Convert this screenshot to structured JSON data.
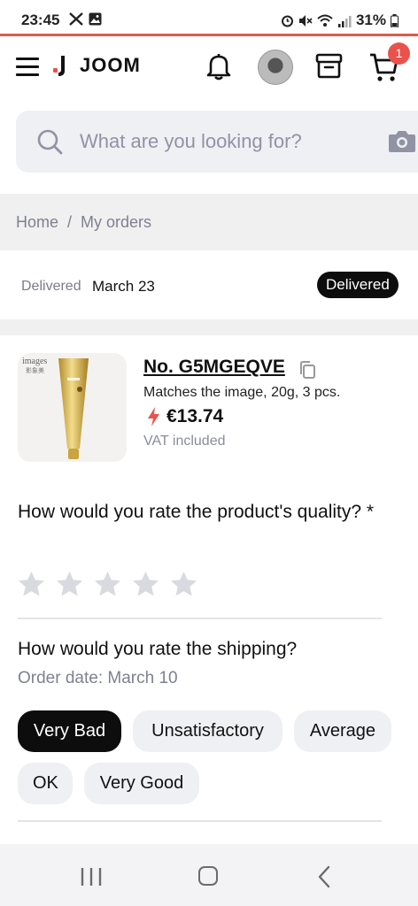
{
  "status_bar": {
    "time": "23:45",
    "battery": "31%",
    "icons": [
      "x-logo-icon",
      "image-icon",
      "alarm-icon",
      "mute-icon",
      "wifi-icon",
      "signal-icon",
      "battery-icon"
    ]
  },
  "header": {
    "brand": "JOOM",
    "cart_count": "1",
    "accent_color": "#e9534b",
    "icons": [
      "menu-icon",
      "bell-icon",
      "avatar",
      "archive-box-icon",
      "cart-icon"
    ]
  },
  "search": {
    "placeholder": "What are you looking for?",
    "value": ""
  },
  "breadcrumb": {
    "home": "Home",
    "separator": "/",
    "current": "My orders"
  },
  "order_status": {
    "label": "Delivered",
    "date": "March 23",
    "badge": "Delivered"
  },
  "product": {
    "image_text_1": "images",
    "image_text_2": "影象美",
    "order_number": "No. G5MGEQVE",
    "variant": "Matches the image, 20g, 3 pcs.",
    "price": "€13.74",
    "vat": "VAT included"
  },
  "quality_rating": {
    "question": "How would you rate the product's quality? *",
    "stars_total": 5,
    "stars_selected": 0
  },
  "shipping_rating": {
    "question": "How would you rate the shipping?",
    "order_date": "Order date: March 10",
    "options": [
      "Very Bad",
      "Unsatisfactory",
      "Average",
      "OK",
      "Very Good"
    ],
    "selected": "Very Bad"
  },
  "nav_bar": {
    "buttons": [
      "recent-apps-button",
      "home-button",
      "back-button"
    ]
  }
}
